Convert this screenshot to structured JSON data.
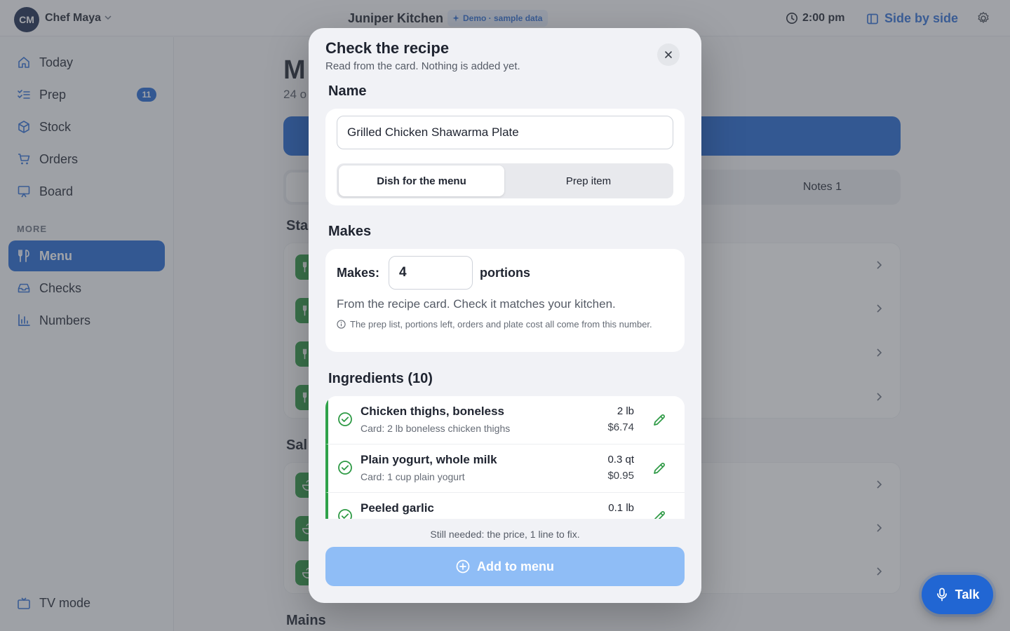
{
  "user": {
    "initials": "CM",
    "name": "Chef Maya"
  },
  "header": {
    "app_title": "Juniper Kitchen",
    "demo_badge": "Demo · sample data",
    "time": "2:00 pm",
    "side_by_side": "Side by side"
  },
  "sidebar": {
    "items": [
      {
        "label": "Today",
        "icon": "home-icon"
      },
      {
        "label": "Prep",
        "icon": "checklist-icon",
        "badge": "11"
      },
      {
        "label": "Stock",
        "icon": "box-icon"
      },
      {
        "label": "Orders",
        "icon": "cart-icon"
      },
      {
        "label": "Board",
        "icon": "board-icon"
      }
    ],
    "section_label": "MORE",
    "more_items": [
      {
        "label": "Menu",
        "icon": "utensils-icon",
        "active": true
      },
      {
        "label": "Checks",
        "icon": "inbox-icon"
      },
      {
        "label": "Numbers",
        "icon": "bar-chart-icon"
      }
    ],
    "tv_mode": "TV mode"
  },
  "main": {
    "title_partial": "M",
    "subtitle_partial": "24 o",
    "tab_notes": "Notes 1",
    "section_starters": "Sta",
    "section_salads": "Sal",
    "section_mains": "Mains"
  },
  "talk_label": "Talk",
  "modal": {
    "title": "Check the recipe",
    "subtitle": "Read from the card. Nothing is added yet.",
    "name_heading": "Name",
    "name_value": "Grilled Chicken Shawarma Plate",
    "type_options": [
      "Dish for the menu",
      "Prep item"
    ],
    "type_selected": "Dish for the menu",
    "makes_heading": "Makes",
    "makes_label": "Makes:",
    "makes_value": "4",
    "makes_unit": "portions",
    "makes_note": "From the recipe card. Check it matches your kitchen.",
    "makes_info": "The prep list, portions left, orders and plate cost all come from this number.",
    "ingredients_heading": "Ingredients (10)",
    "ingredients": [
      {
        "name": "Chicken thighs, boneless",
        "card": "Card: 2 lb boneless chicken thighs",
        "qty": "2 lb",
        "cost": "$6.74"
      },
      {
        "name": "Plain yogurt, whole milk",
        "card": "Card: 1 cup plain yogurt",
        "qty": "0.3 qt",
        "cost": "$0.95"
      },
      {
        "name": "Peeled garlic",
        "card": "",
        "qty": "0.1 lb",
        "cost": ""
      }
    ],
    "still_needed": "Still needed: the price, 1 line to fix.",
    "add_button": "Add to menu"
  },
  "colors": {
    "accent": "#2166d3",
    "success": "#2e9a45",
    "disabled_button": "#8fbdf6"
  }
}
